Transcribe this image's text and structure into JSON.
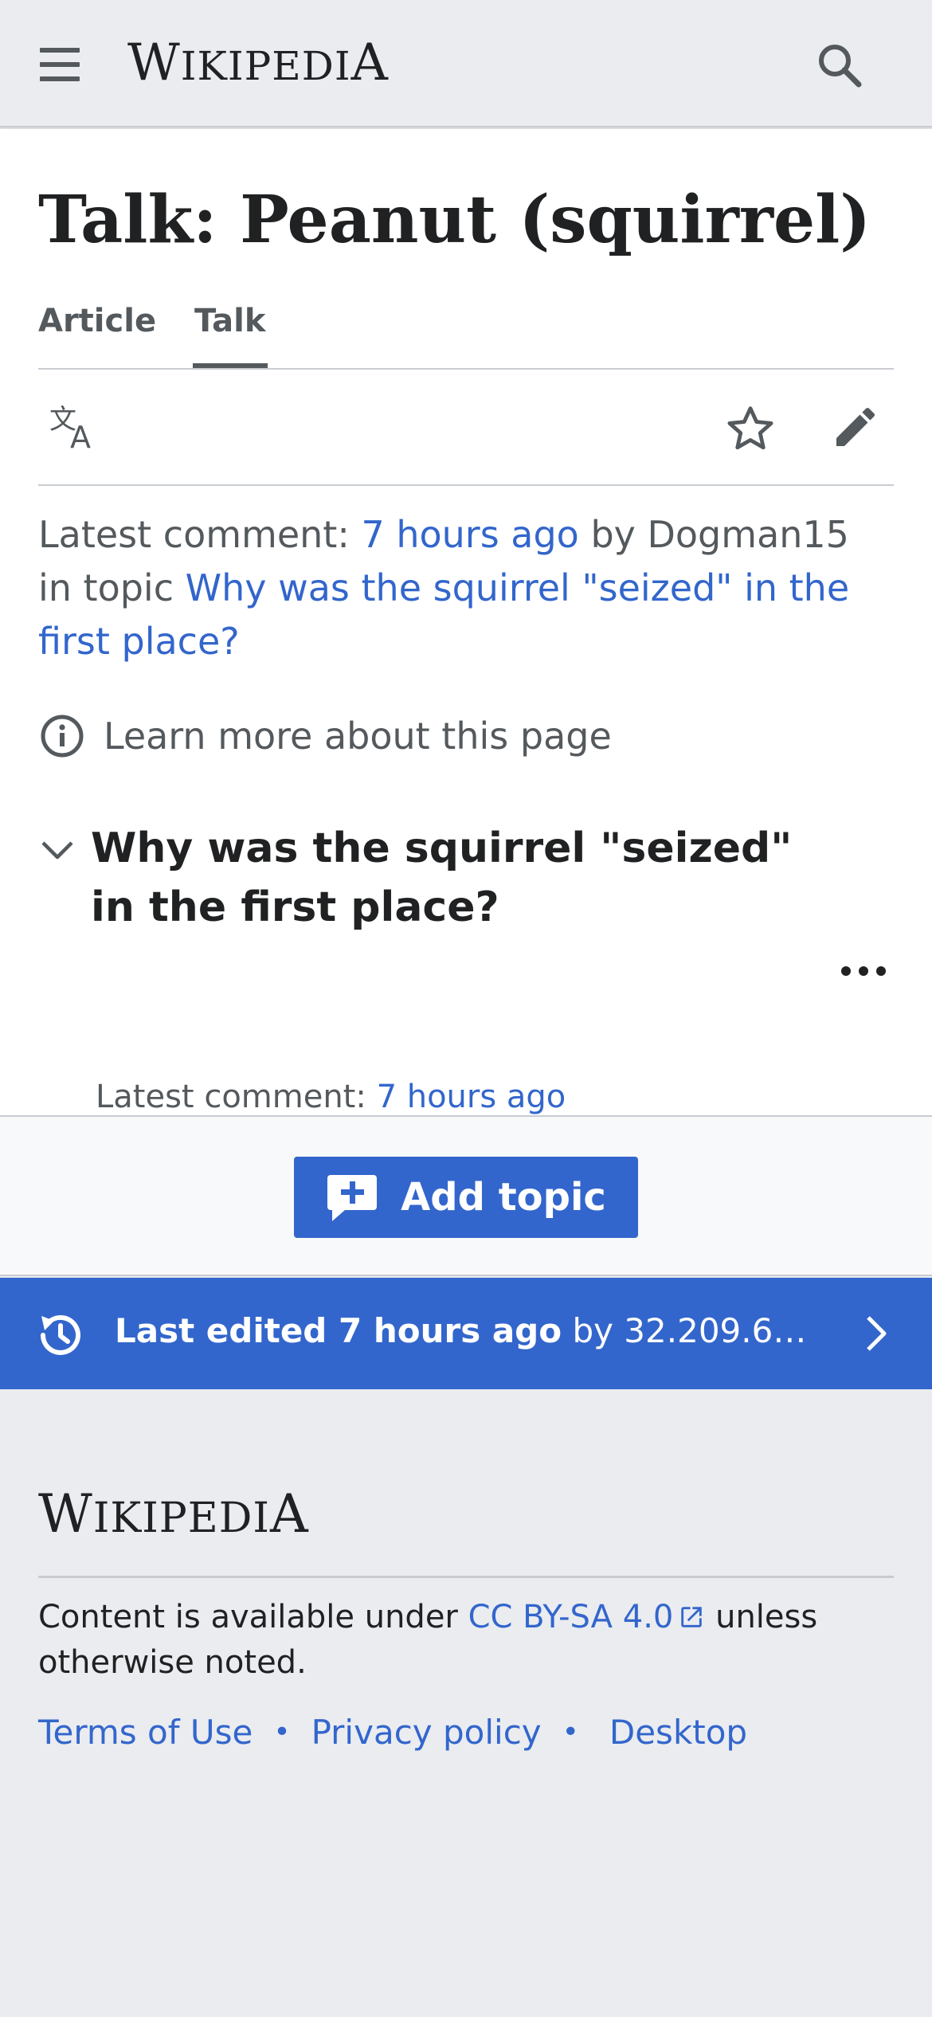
{
  "header": {
    "wordmark": "Wikipedia",
    "menu_icon": "hamburger-menu-icon",
    "search_icon": "search-icon"
  },
  "page": {
    "title": "Talk: Peanut (squirrel)",
    "tabs": [
      {
        "label": "Article",
        "selected": false
      },
      {
        "label": "Talk",
        "selected": true
      }
    ]
  },
  "actions": {
    "language_icon": "language-icon",
    "watch_icon": "star-icon",
    "edit_icon": "pencil-icon"
  },
  "latest_comment": {
    "prefix": "Latest comment: ",
    "time_link": "7 hours ago",
    "by_text": " by Dogman15",
    "in_topic_text": "in topic ",
    "topic_link": "Why was the squirrel \"seized\" in the first place?"
  },
  "learn_more": {
    "label": "Learn more about this page",
    "icon": "info-icon"
  },
  "topic": {
    "heading": "Why was the squirrel \"seized\" in the first place?",
    "latest_prefix": "Latest comment: ",
    "latest_link": "7 hours ago",
    "collapse_icon": "chevron-down-icon",
    "more_icon": "ellipsis-icon"
  },
  "add_topic": {
    "label": "Add topic",
    "icon": "speech-bubble-add-icon"
  },
  "last_edited": {
    "bold_text": "Last edited 7 hours ago",
    "by_text": " by 32.209.6…",
    "icon": "history-icon",
    "chevron_icon": "chevron-right-icon"
  },
  "footer": {
    "wordmark": "Wikipedia",
    "license_prefix": "Content is available under ",
    "license_link": "CC BY-SA 4.0",
    "license_suffix": " unless otherwise noted.",
    "links": [
      "Terms of Use",
      "Privacy policy",
      "Desktop"
    ],
    "external_icon": "external-link-icon"
  },
  "colors": {
    "link": "#3366cc",
    "background": "#eaecf0",
    "text": "#202122",
    "muted": "#54595d"
  }
}
